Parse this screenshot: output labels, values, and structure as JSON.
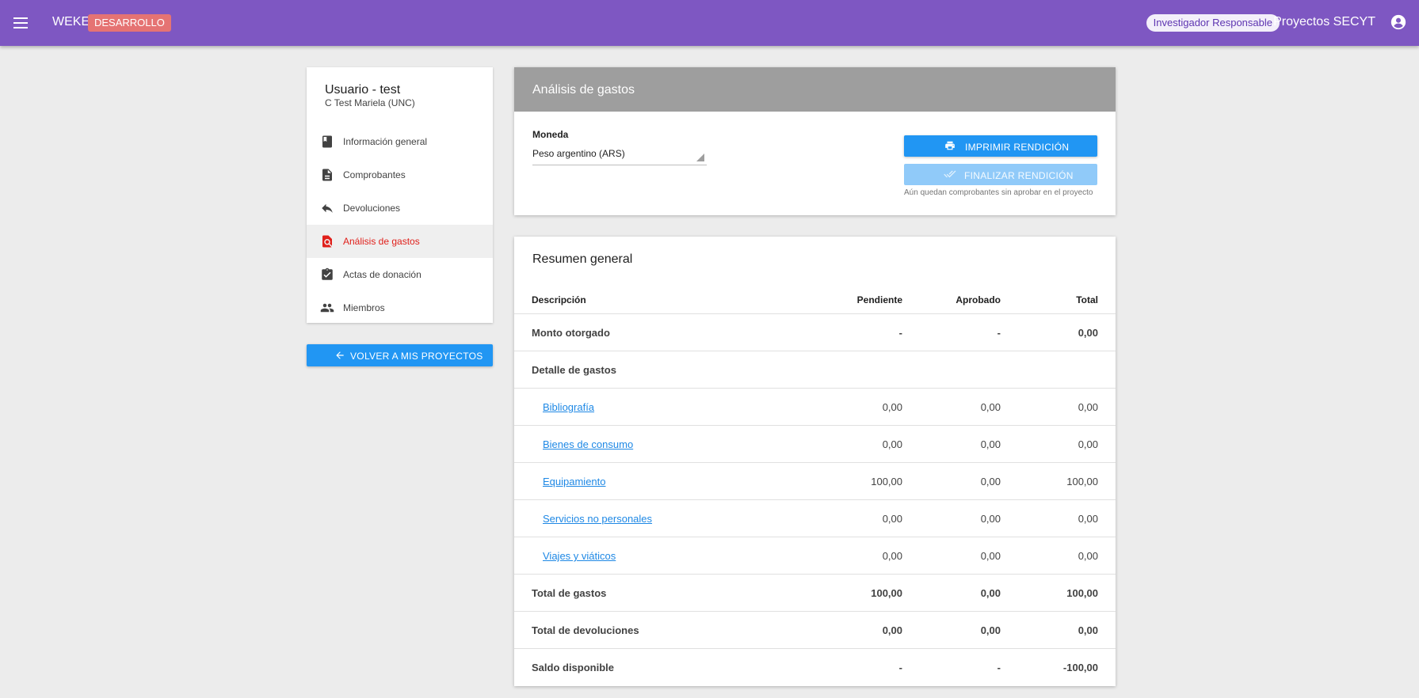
{
  "topbar": {
    "app_name": "WEKE",
    "env_badge": "DESARROLLO",
    "role": "Investigador Responsable",
    "project_link": "Proyectos SECYT",
    "bg_color": "#7e57c2"
  },
  "sidebar": {
    "user_name": "Usuario - test",
    "user_sub": "C Test Mariela (UNC)",
    "items": [
      {
        "label": "Información general",
        "icon": "book-icon"
      },
      {
        "label": "Comprobantes",
        "icon": "document-icon"
      },
      {
        "label": "Devoluciones",
        "icon": "reply-icon"
      },
      {
        "label": "Análisis de gastos",
        "icon": "search-document-icon",
        "active": true
      },
      {
        "label": "Actas de donación",
        "icon": "clipboard-check-icon"
      },
      {
        "label": "Miembros",
        "icon": "people-icon"
      }
    ],
    "back_button": "VOLVER A MIS PROYECTOS"
  },
  "analysis": {
    "title": "Análisis de gastos",
    "currency_label": "Moneda",
    "currency_value": "Peso argentino (ARS)",
    "print_button": "IMPRIMIR RENDICIÓN",
    "finish_button": "FINALIZAR RENDICIÓN",
    "finish_hint": "Aún quedan comprobantes sin aprobar en el proyecto"
  },
  "summary": {
    "title": "Resumen general",
    "columns": [
      "Descripción",
      "Pendiente",
      "Aprobado",
      "Total"
    ],
    "rows": [
      {
        "desc": "Monto otorgado",
        "pendiente": "-",
        "aprobado": "-",
        "total": "0,00"
      },
      {
        "desc": "Detalle de gastos",
        "pendiente": "",
        "aprobado": "",
        "total": ""
      },
      {
        "desc": "Bibliografía",
        "pendiente": "0,00",
        "aprobado": "0,00",
        "total": "0,00"
      },
      {
        "desc": "Bienes de consumo",
        "pendiente": "0,00",
        "aprobado": "0,00",
        "total": "0,00"
      },
      {
        "desc": "Equipamiento",
        "pendiente": "100,00",
        "aprobado": "0,00",
        "total": "100,00"
      },
      {
        "desc": "Servicios no personales",
        "pendiente": "0,00",
        "aprobado": "0,00",
        "total": "0,00"
      },
      {
        "desc": "Viajes y viáticos",
        "pendiente": "0,00",
        "aprobado": "0,00",
        "total": "0,00"
      },
      {
        "desc": "Total de gastos",
        "pendiente": "100,00",
        "aprobado": "0,00",
        "total": "100,00"
      },
      {
        "desc": "Total de devoluciones",
        "pendiente": "0,00",
        "aprobado": "0,00",
        "total": "0,00"
      },
      {
        "desc": "Saldo disponible",
        "pendiente": "-",
        "aprobado": "-",
        "total": "-100,00"
      }
    ]
  }
}
